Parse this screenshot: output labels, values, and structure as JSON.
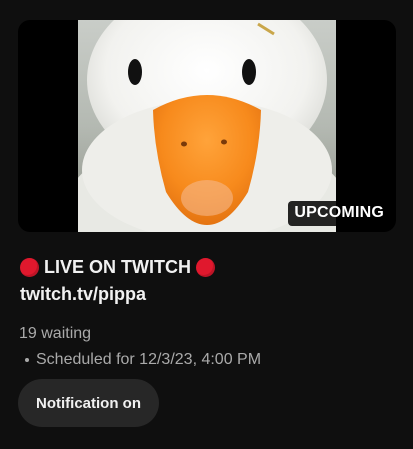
{
  "video": {
    "thumbnail": "white duck with orange beak close-up",
    "badge": "UPCOMING",
    "title_line1": "LIVE ON TWITCH",
    "title_line2": "twitch.tv/pippa",
    "waiting": "19 waiting",
    "scheduled": "Scheduled for 12/3/23, 4:00 PM"
  },
  "actions": {
    "notification_label": "Notification on"
  },
  "colors": {
    "background": "#0f0f0f",
    "badge_bg": "#000000",
    "live_dot": "#e0182d",
    "button_bg": "#272727",
    "secondary_text": "#aaaaaa"
  }
}
